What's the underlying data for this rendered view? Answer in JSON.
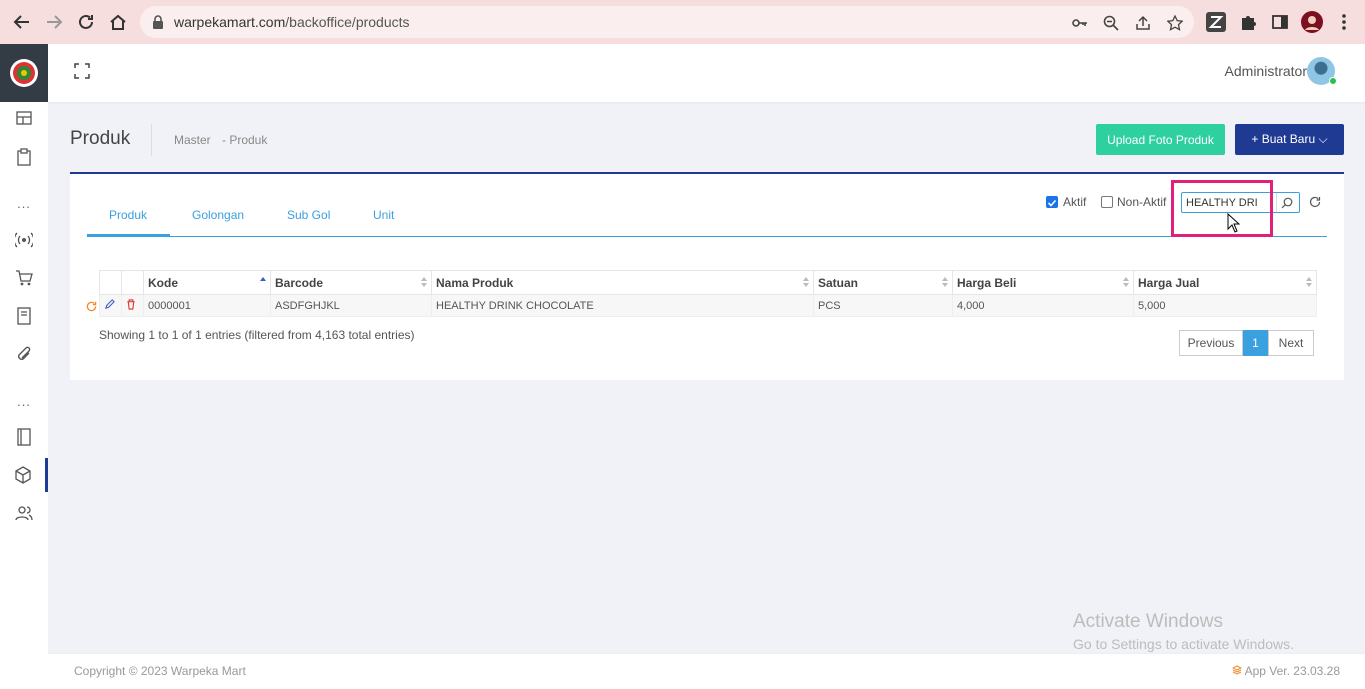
{
  "browser": {
    "url_host": "warpekamart.com",
    "url_path": "/backoffice/products"
  },
  "sidebar": {
    "items": [
      "dashboard-icon",
      "clipboard-icon",
      "broadcast-icon",
      "cart-icon",
      "receipt-icon",
      "paperclip-icon",
      "notebook-icon",
      "box-icon",
      "users-icon"
    ],
    "dots": "..."
  },
  "topbar": {
    "user_name": "Administrator"
  },
  "page": {
    "title": "Produk",
    "breadcrumb_1": "Master",
    "breadcrumb_2": "- Produk",
    "upload_button": "Upload Foto Produk",
    "create_button": "+ Buat Baru"
  },
  "tabs": [
    "Produk",
    "Golongan",
    "Sub Gol",
    "Unit"
  ],
  "filters": {
    "aktif_label": "Aktif",
    "aktif_checked": true,
    "nonaktif_label": "Non-Aktif",
    "nonaktif_checked": false,
    "search_value": "HEALTHY DRI"
  },
  "table": {
    "columns": [
      "Kode",
      "Barcode",
      "Nama Produk",
      "Satuan",
      "Harga Beli",
      "Harga Jual"
    ],
    "rows": [
      [
        "0000001",
        "ASDFGHJKL",
        "HEALTHY DRINK CHOCOLATE",
        "PCS",
        "4,000",
        "5,000"
      ]
    ],
    "info": "Showing 1 to 1 of 1 entries (filtered from 4,163 total entries)"
  },
  "pagination": {
    "previous": "Previous",
    "current": "1",
    "next": "Next"
  },
  "watermark": {
    "line1": "Activate Windows",
    "line2": "Go to Settings to activate Windows."
  },
  "footer": {
    "copyright": "Copyright © 2023 Warpeka Mart",
    "version": "App Ver. 23.03.28"
  },
  "colors": {
    "brand": "#1f3a93",
    "accent": "#3aa0e0",
    "upload": "#2fd0a0",
    "highlight": "#e0207a"
  }
}
